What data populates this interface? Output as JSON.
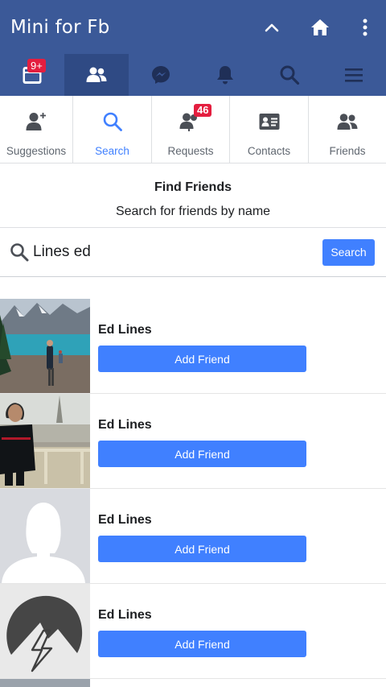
{
  "app": {
    "title": "Mini for Fb"
  },
  "navbar": {
    "notifications_badge": "9+"
  },
  "subtabs": [
    {
      "label": "Suggestions",
      "icon": "person-add-icon"
    },
    {
      "label": "Search",
      "icon": "search-icon"
    },
    {
      "label": "Requests",
      "icon": "friend-requests-icon",
      "badge": "46"
    },
    {
      "label": "Contacts",
      "icon": "contact-card-icon"
    },
    {
      "label": "Friends",
      "icon": "friends-icon"
    }
  ],
  "find": {
    "title": "Find Friends",
    "subtitle": "Search for friends by name"
  },
  "search": {
    "value": "Lines ed",
    "button": "Search"
  },
  "results": [
    {
      "name": "Ed Lines",
      "button": "Add Friend",
      "photo": "lake-mountain-photo"
    },
    {
      "name": "Ed Lines",
      "button": "Add Friend",
      "photo": "paris-balcony-photo"
    },
    {
      "name": "Ed Lines",
      "button": "Add Friend",
      "photo": "default-female-avatar"
    },
    {
      "name": "Ed Lines",
      "button": "Add Friend",
      "photo": "lightning-logo-avatar"
    }
  ],
  "colors": {
    "brand": "#3b5998",
    "accent": "#4080ff",
    "badge": "#e41e3f"
  }
}
